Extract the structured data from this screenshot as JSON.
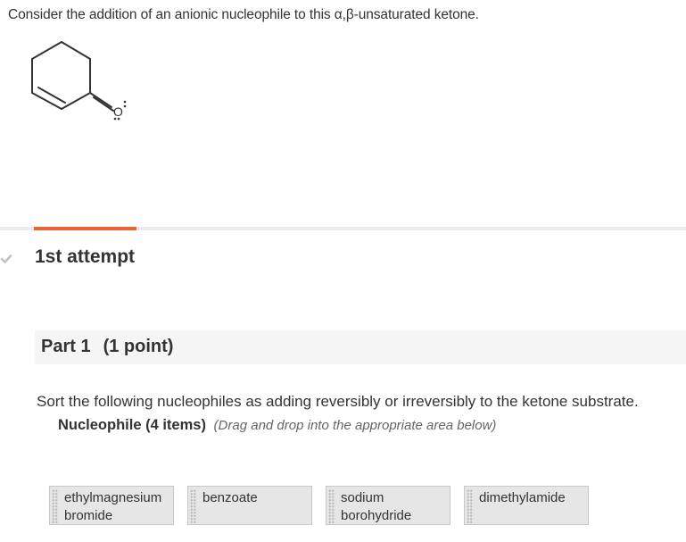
{
  "question": {
    "text": "Consider the addition of an anionic nucleophile to this α,β-unsaturated ketone."
  },
  "molecule": {
    "atom_label": "O",
    "bond_color": "#333333"
  },
  "attempt": {
    "label": "1st attempt",
    "accent_color": "#e8643c"
  },
  "part": {
    "title": "Part 1",
    "points": "(1 point)"
  },
  "instructions": "Sort the following nucleophiles as adding reversibly or irreversibly to the ketone substrate.",
  "group": {
    "count_label": "Nucleophile (4 items)",
    "hint": "(Drag and drop into the appropriate area below)"
  },
  "items": [
    {
      "label": "ethylmagnesium bromide"
    },
    {
      "label": "benzoate"
    },
    {
      "label": "sodium borohydride"
    },
    {
      "label": "dimethylamide"
    }
  ]
}
